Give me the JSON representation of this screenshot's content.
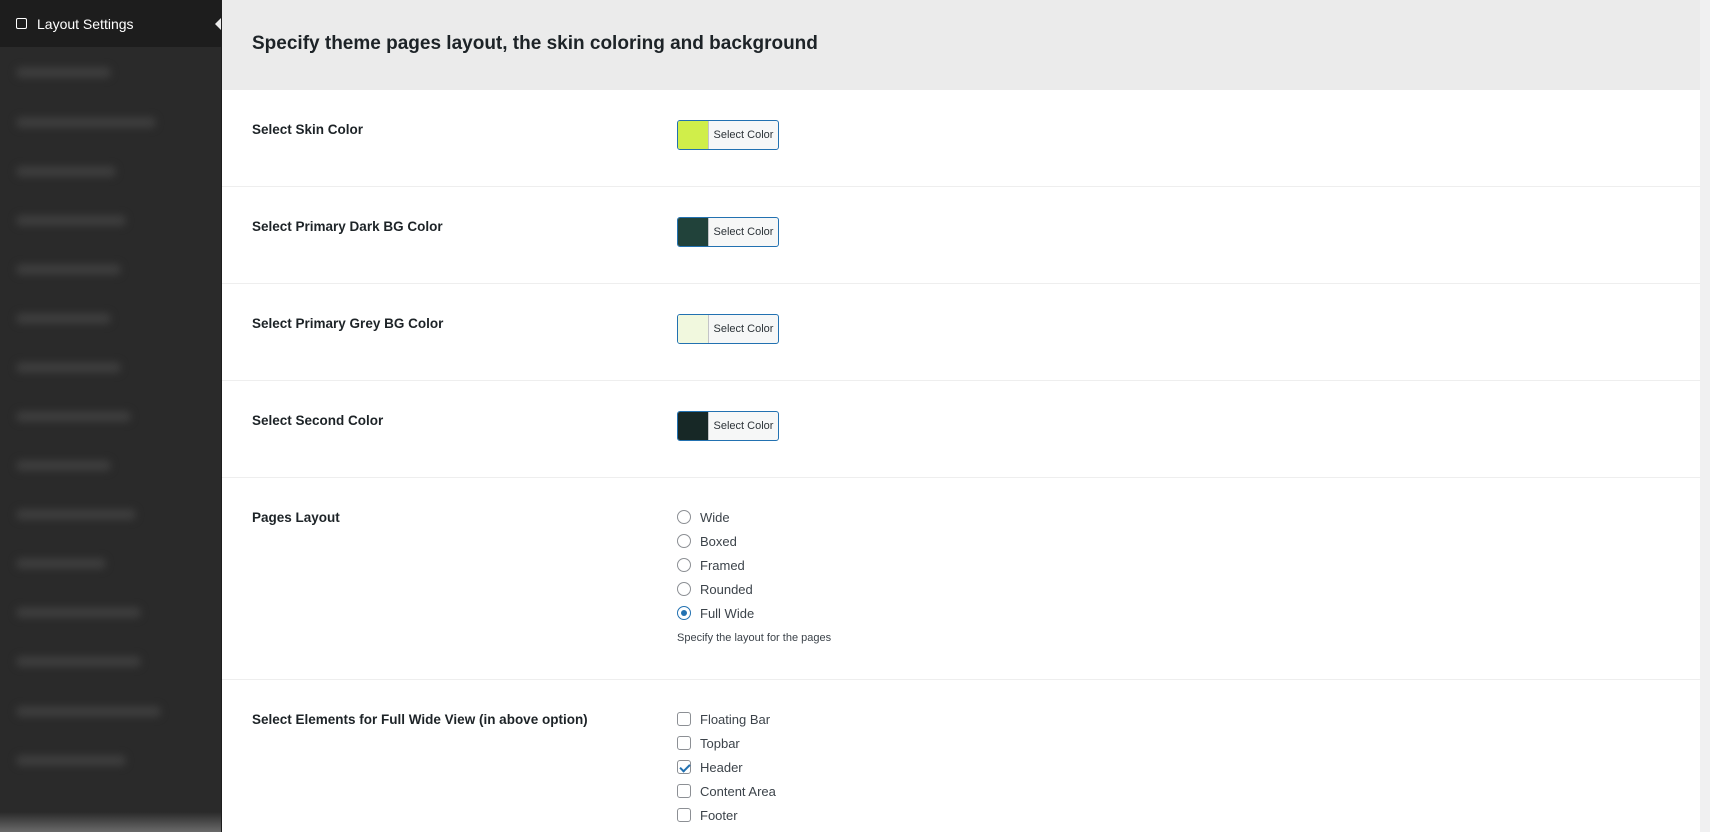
{
  "sidebar": {
    "active_item": "Layout Settings"
  },
  "header": {
    "title": "Specify theme pages layout, the skin coloring and background"
  },
  "color_rows": [
    {
      "label": "Select Skin Color",
      "button": "Select Color",
      "color": "#d0ee4a"
    },
    {
      "label": "Select Primary Dark BG Color",
      "button": "Select Color",
      "color": "#21423a"
    },
    {
      "label": "Select Primary Grey BG Color",
      "button": "Select Color",
      "color": "#f1f8de"
    },
    {
      "label": "Select Second Color",
      "button": "Select Color",
      "color": "#172826"
    }
  ],
  "pages_layout": {
    "label": "Pages Layout",
    "options": [
      "Wide",
      "Boxed",
      "Framed",
      "Rounded",
      "Full Wide"
    ],
    "selected": "Full Wide",
    "description": "Specify the layout for the pages"
  },
  "full_wide_elements": {
    "label": "Select Elements for Full Wide View (in above option)",
    "options": [
      "Floating Bar",
      "Topbar",
      "Header",
      "Content Area",
      "Footer"
    ],
    "checked": [
      "Header"
    ]
  },
  "colors": {
    "accent": "#2271b1",
    "sidebar_bg": "#2a2a2a",
    "header_bg": "#ebebeb"
  }
}
